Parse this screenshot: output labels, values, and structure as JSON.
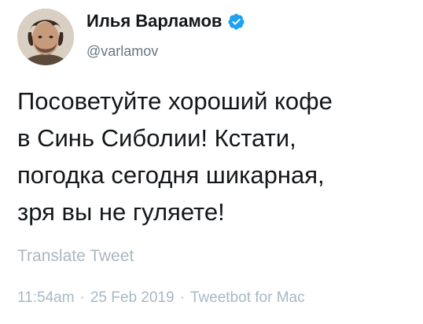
{
  "author": {
    "name": "Илья Варламов",
    "handle": "@varlamov",
    "verified": true,
    "verified_color": "#1da1f2"
  },
  "tweet": {
    "lines": [
      "Посоветуйте хороший кофе",
      "в Синь Сиболии! Кстати,",
      "погодка сегодня шикарная,",
      "зря вы не гуляете!"
    ]
  },
  "translate_label": "Translate Tweet",
  "meta": {
    "time": "11:54am",
    "separator": "·",
    "date": "25 Feb 2019",
    "source": "Tweetbot for Mac"
  },
  "icons": {
    "avatar": "user-photo-avatar",
    "verified": "verified-badge-icon"
  }
}
